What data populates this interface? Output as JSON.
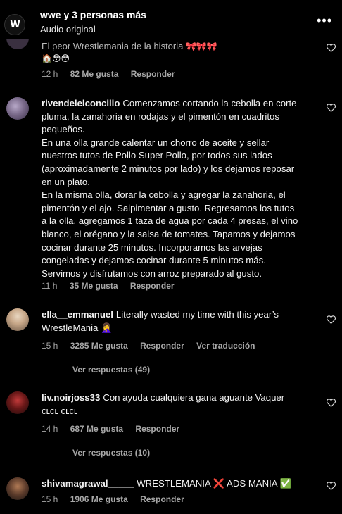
{
  "header": {
    "title": "wwe y 3 personas más",
    "subtitle": "Audio original",
    "more": "•••",
    "avatar_letter": "W"
  },
  "comments": [
    {
      "username": "",
      "text_visible": "El peor Wrestlemania de la historia",
      "time": "12 h",
      "likes": "82 Me gusta",
      "reply": "Responder"
    },
    {
      "username": "rivendelelconcilio",
      "text": "Comenzamos cortando la cebolla en corte pluma, la zanahoria en rodajas y el pimentón en cuadritos pequeños.\nEn una olla grande calentar un chorro de aceite y sellar nuestros tutos de Pollo Super Pollo, por todos sus lados (aproximadamente 2 minutos por lado) y los dejamos reposar en un plato.\nEn la misma olla, dorar la cebolla y agregar la zanahoria, el pimentón y el ajo. Salpimentar a gusto. Regresamos los tutos a la olla, agregamos 1 taza de agua por cada 4 presas, el vino blanco, el orégano y la salsa de tomates. Tapamos y dejamos cocinar durante 25 minutos. Incorporamos las arvejas congeladas y dejamos cocinar durante 5 minutos más. Servimos y disfrutamos con arroz preparado al gusto.",
      "time": "11 h",
      "likes": "35 Me gusta",
      "reply": "Responder"
    },
    {
      "username": "ella__emmanuel",
      "text": "Literally wasted my time with this year’s WrestleMania 🤦‍♀️",
      "time": "15 h",
      "likes": "3285 Me gusta",
      "reply": "Responder",
      "translate": "Ver traducción",
      "view_replies": "Ver respuestas (49)"
    },
    {
      "username": "liv.noirjoss33",
      "text": "Con ayuda cualquiera gana aguante Vaquer ᴄʟᴄʟ ᴄʟᴄʟ",
      "time": "14 h",
      "likes": "687 Me gusta",
      "reply": "Responder",
      "view_replies": "Ver respuestas (10)"
    },
    {
      "username": "shivamagrawal_____",
      "text": "WRESTLEMANIA ❌ ADS MANIA ✅",
      "time": "15 h",
      "likes": "1906 Me gusta",
      "reply": "Responder"
    }
  ]
}
